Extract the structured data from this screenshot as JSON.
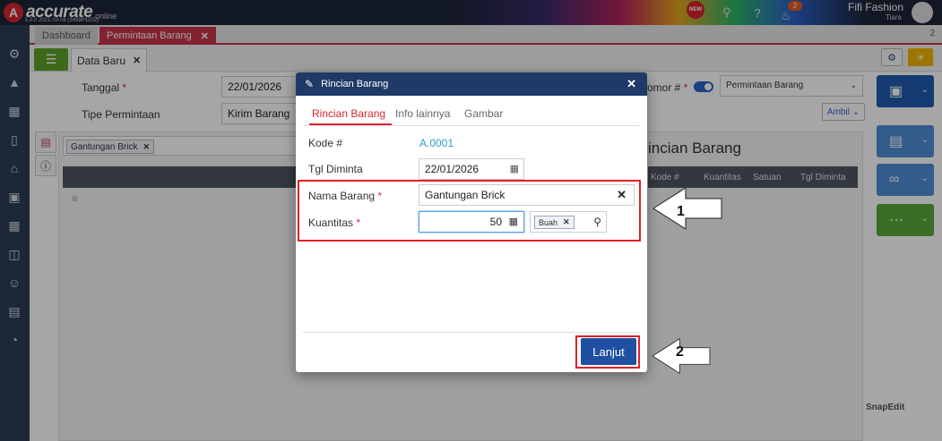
{
  "app": {
    "logo_text": "accurate",
    "logo_sub": "online",
    "version": "5.0.0 2021-03-08 (3499P1202)",
    "new_badge": "NEW",
    "notif_count": "2",
    "company": "Fifi Fashion",
    "user": "Tiara"
  },
  "tabs": {
    "dashboard": "Dashboard",
    "permintaan": "Permintaan Barang",
    "count": "2"
  },
  "subtab": {
    "label": "Data Baru"
  },
  "form": {
    "tanggal_label": "Tanggal",
    "tanggal_value": "22/01/2026",
    "tipe_label": "Tipe Permintaan",
    "tipe_value": "Kirim Barang",
    "nomor_label": "omor #",
    "nomor_select": "Permintaan Barang",
    "ambil": "Ambil",
    "chip": "Gantungan Brick",
    "rincian_title": "incian Barang",
    "grid_headers": [
      "Kode #",
      "Kuantitas",
      "Satuan",
      "Tgl Diminta"
    ]
  },
  "modal": {
    "title": "Rincian Barang",
    "tabs": [
      "Rincian Barang",
      "Info lainnya",
      "Gambar"
    ],
    "kode_label": "Kode #",
    "kode_value": "A.0001",
    "tgl_label": "Tgl Diminta",
    "tgl_value": "22/01/2026",
    "nama_label": "Nama Barang",
    "nama_value": "Gantungan Brick",
    "kuantitas_label": "Kuantitas",
    "kuantitas_value": "50",
    "satuan_value": "Buah",
    "submit": "Lanjut"
  },
  "callouts": {
    "one": "1",
    "two": "2"
  },
  "watermark": "SnapEdit",
  "colors": {
    "brand_red": "#d8262e",
    "primary_blue": "#1f4fa0",
    "highlight_red": "#e0202a",
    "nav_dark": "#2c3e56"
  }
}
